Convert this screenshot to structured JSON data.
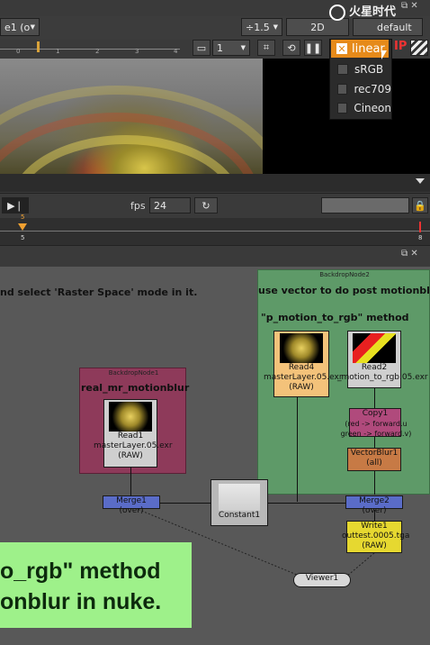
{
  "viewer": {
    "channel_combo": "e1 (o",
    "gain_value": "÷1.5",
    "view_mode": "2D",
    "lut_button": "default",
    "watermark": "火星时代",
    "frame_value": "1",
    "lut_menu": {
      "selected": "linear",
      "items": [
        "sRGB",
        "rec709",
        "Cineon"
      ]
    },
    "ip_label": "IP",
    "ruler_ticks": [
      "0",
      "1",
      "2",
      "3",
      "4"
    ]
  },
  "playback": {
    "fps_label": "fps",
    "fps_value": "24",
    "current_frame": "5",
    "end_frame": "8"
  },
  "graph": {
    "left_note": "nd select 'Raster Space' mode in it.",
    "backdrop1": {
      "node_name": "BackdropNode1",
      "title": "real_mr_motionblur"
    },
    "backdrop2": {
      "node_name": "BackdropNode2",
      "title": "use vector to do post motionblur",
      "subtitle": "\"p_motion_to_rgb\" method"
    },
    "nodes": {
      "read1": {
        "name": "Read1",
        "file": "masterLayer.05.exr",
        "tag": "(RAW)"
      },
      "read4": {
        "name": "Read4",
        "file": "masterLayer.05.exr",
        "tag": "(RAW)"
      },
      "read2": {
        "name": "Read2",
        "file": "_motion_to_rgb.05.exr",
        "tag": "(RAW)"
      },
      "copy1": {
        "name": "Copy1",
        "line1": "(red -> forward.u",
        "line2": "green -> forward.v)"
      },
      "vectorblur1": {
        "name": "VectorBlur1",
        "tag": "(all)"
      },
      "merge1": {
        "name": "Merge1 (over)"
      },
      "merge2": {
        "name": "Merge2 (over)"
      },
      "constant1": {
        "name": "Constant1"
      },
      "write1": {
        "name": "Write1",
        "file": "outtest.0005.tga",
        "tag": "(RAW)"
      },
      "viewer1": {
        "name": "Viewer1"
      }
    },
    "banner": {
      "line1": "o_rgb\" method",
      "line2": "onblur in nuke."
    }
  },
  "colors": {
    "accent_orange": "#e68a1a",
    "backdrop_red": "#8e3a5a",
    "backdrop_green": "#5e9a68",
    "banner_green": "#9ef18a"
  }
}
